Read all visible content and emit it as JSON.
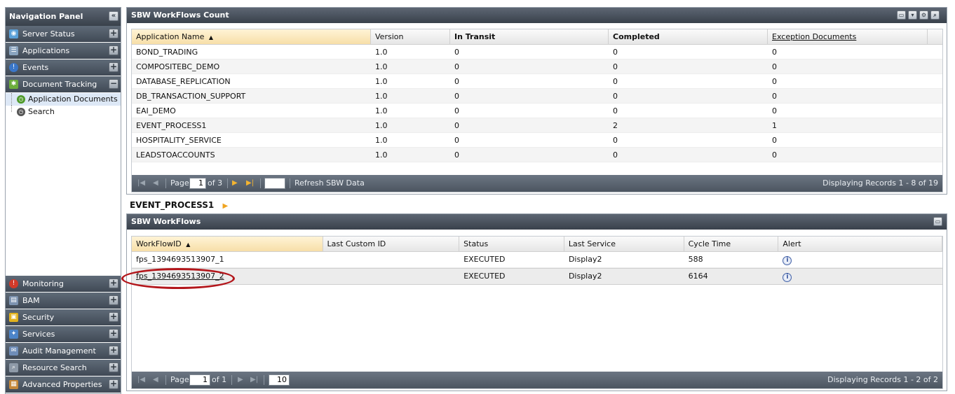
{
  "nav": {
    "title": "Navigation Panel",
    "top_items": [
      {
        "label": "Server Status",
        "icon": "server-status-icon",
        "color": "#5aa0d8"
      },
      {
        "label": "Applications",
        "icon": "applications-icon",
        "color": "#8aa4bf"
      },
      {
        "label": "Events",
        "icon": "events-icon",
        "color": "#3a76c8"
      },
      {
        "label": "Document Tracking",
        "icon": "document-tracking-icon",
        "color": "#6cad3c"
      }
    ],
    "sub_items": [
      {
        "label": "Application Documents",
        "icon": "application-documents-icon",
        "color": "#4f9a2b"
      },
      {
        "label": "Search",
        "icon": "search-clock-icon",
        "color": "#555555"
      }
    ],
    "bottom_items": [
      {
        "label": "Monitoring",
        "icon": "monitoring-icon",
        "color": "#d03a2a"
      },
      {
        "label": "BAM",
        "icon": "bam-icon",
        "color": "#7d93b0"
      },
      {
        "label": "Security",
        "icon": "security-lock-icon",
        "color": "#e2b21e"
      },
      {
        "label": "Services",
        "icon": "services-icon",
        "color": "#4c84c8"
      },
      {
        "label": "Audit Management",
        "icon": "audit-management-icon",
        "color": "#6f8db8"
      },
      {
        "label": "Resource Search",
        "icon": "resource-search-icon",
        "color": "#8e9aa8"
      },
      {
        "label": "Advanced Properties",
        "icon": "advanced-properties-icon",
        "color": "#c5883a"
      }
    ]
  },
  "count_panel": {
    "title": "SBW WorkFlows Count",
    "columns": [
      "Application Name",
      "Version",
      "In Transit",
      "Completed",
      "Exception Documents"
    ],
    "rows": [
      [
        "BOND_TRADING",
        "1.0",
        "0",
        "0",
        "0"
      ],
      [
        "COMPOSITEBC_DEMO",
        "1.0",
        "0",
        "0",
        "0"
      ],
      [
        "DATABASE_REPLICATION",
        "1.0",
        "0",
        "0",
        "0"
      ],
      [
        "DB_TRANSACTION_SUPPORT",
        "1.0",
        "0",
        "0",
        "0"
      ],
      [
        "EAI_DEMO",
        "1.0",
        "0",
        "0",
        "0"
      ],
      [
        "EVENT_PROCESS1",
        "1.0",
        "0",
        "2",
        "1"
      ],
      [
        "HOSPITALITY_SERVICE",
        "1.0",
        "0",
        "0",
        "0"
      ],
      [
        "LEADSTOACCOUNTS",
        "1.0",
        "0",
        "0",
        "0"
      ]
    ],
    "pager": {
      "page_label": "Page",
      "page_value": "1",
      "of_label": "of 3",
      "page_size": "",
      "refresh_label": "Refresh SBW Data",
      "display_text": "Displaying Records 1 - 8 of 19"
    }
  },
  "breadcrumb": {
    "label": "EVENT_PROCESS1",
    "arrow": "▶"
  },
  "workflows_panel": {
    "title": "SBW WorkFlows",
    "columns": [
      "WorkFlowID",
      "Last Custom ID",
      "Status",
      "Last Service",
      "Cycle Time",
      "Alert"
    ],
    "rows": [
      {
        "id": "fps_1394693513907_1",
        "custom": "",
        "status": "EXECUTED",
        "service": "Display2",
        "cycle": "588",
        "alert": "i"
      },
      {
        "id": "fps_1394693513907_2",
        "custom": "",
        "status": "EXECUTED",
        "service": "Display2",
        "cycle": "6164",
        "alert": "i"
      }
    ],
    "pager": {
      "page_label": "Page",
      "page_value": "1",
      "of_label": "of 1",
      "page_size": "10",
      "display_text": "Displaying Records 1 - 2 of 2"
    }
  },
  "glyphs": {
    "collapse": "«",
    "plus": "+",
    "minus": "−",
    "sort_asc": "▲",
    "first": "|◀",
    "prev": "◀",
    "next": "▶",
    "last": "▶|",
    "restore": "▭",
    "expand": "▾",
    "settings": "⚙",
    "search": "⌕"
  }
}
